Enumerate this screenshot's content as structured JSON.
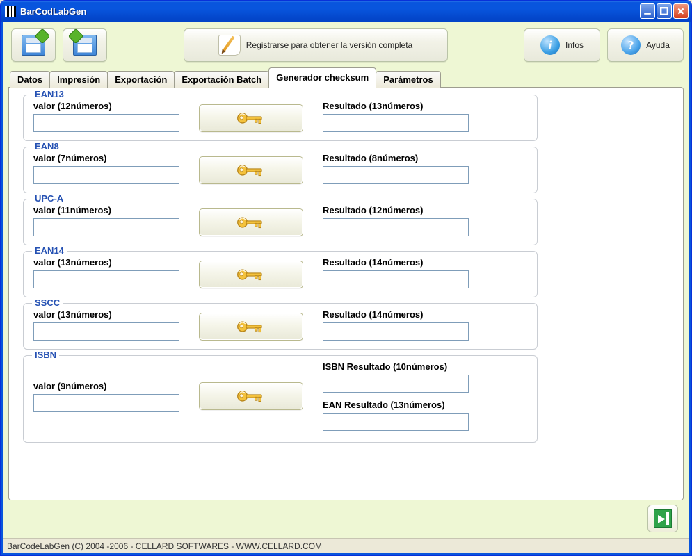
{
  "window": {
    "title": "BarCodLabGen"
  },
  "toolbar": {
    "register_label": "Registrarse para obtener la versión completa",
    "infos_label": "Infos",
    "help_label": "Ayuda"
  },
  "tabs": {
    "items": [
      {
        "label": "Datos"
      },
      {
        "label": "Impresión"
      },
      {
        "label": "Exportación"
      },
      {
        "label": "Exportación Batch"
      },
      {
        "label": "Generador checksum"
      },
      {
        "label": "Parámetros"
      }
    ],
    "active_index": 4
  },
  "groups": [
    {
      "title": "EAN13",
      "valor_label": "valor (12números)",
      "result_label": "Resultado (13números)",
      "valor": "",
      "result": ""
    },
    {
      "title": "EAN8",
      "valor_label": "valor (7números)",
      "result_label": "Resultado (8números)",
      "valor": "",
      "result": ""
    },
    {
      "title": "UPC-A",
      "valor_label": "valor (11números)",
      "result_label": "Resultado (12números)",
      "valor": "",
      "result": ""
    },
    {
      "title": "EAN14",
      "valor_label": "valor (13números)",
      "result_label": "Resultado (14números)",
      "valor": "",
      "result": ""
    },
    {
      "title": "SSCC",
      "valor_label": "valor (13números)",
      "result_label": "Resultado (14números)",
      "valor": "",
      "result": ""
    }
  ],
  "isbn": {
    "title": "ISBN",
    "valor_label": "valor (9números)",
    "isbn_result_label": "ISBN Resultado (10números)",
    "ean_result_label": "EAN Resultado (13números)",
    "valor": "",
    "isbn_result": "",
    "ean_result": ""
  },
  "status": "BarCodeLabGen (C) 2004 -2006 - CELLARD SOFTWARES - WWW.CELLARD.COM"
}
